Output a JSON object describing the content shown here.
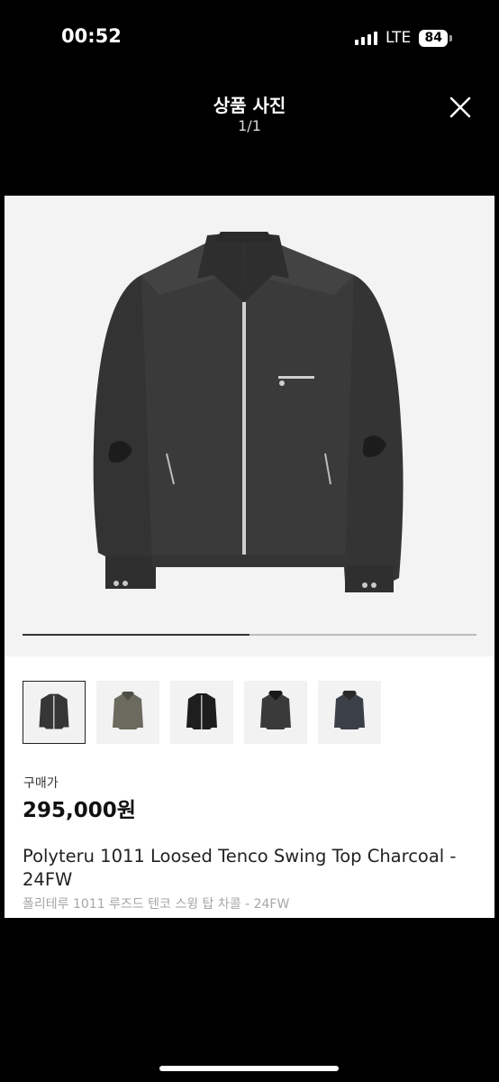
{
  "status_bar": {
    "time": "00:52",
    "network": "LTE",
    "battery": "84"
  },
  "header": {
    "title": "상품 사진",
    "counter": "1/1",
    "close_icon": "close-icon"
  },
  "gallery": {
    "main_image": "charcoal-zip-jacket",
    "progress": 0.5,
    "thumbnails": [
      {
        "label": "charcoal-jacket",
        "selected": true
      },
      {
        "label": "olive-jacket",
        "selected": false
      },
      {
        "label": "black-jacket",
        "selected": false
      },
      {
        "label": "charcoal-jacket-fur-collar",
        "selected": false
      },
      {
        "label": "navy-jacket-fur-collar",
        "selected": false
      }
    ]
  },
  "product": {
    "price_label": "구매가",
    "price": "295,000원",
    "name_en": "Polyteru 1011 Loosed Tenco Swing Top Charcoal - 24FW",
    "name_ko": "폴리테루 1011 루즈드 텐코 스윙 탑 차콜 - 24FW"
  },
  "colors": {
    "background": "#000000",
    "jacket": "#3a3a3a",
    "olive": "#6b6a5e",
    "navy": "#3b4048"
  }
}
